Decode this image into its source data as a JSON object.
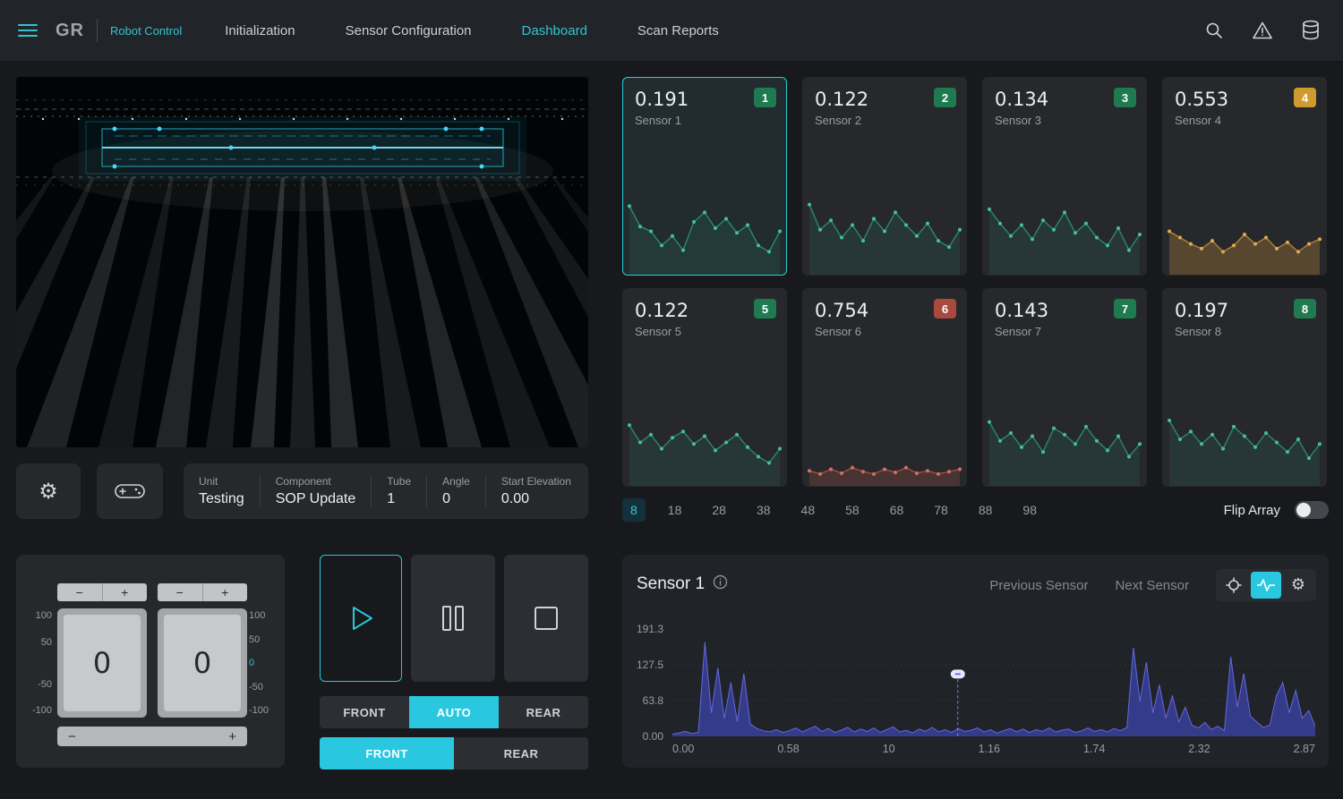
{
  "nav": {
    "logo": "GR",
    "brand": "Robot Control",
    "items": [
      {
        "label": "Initialization",
        "active": false
      },
      {
        "label": "Sensor Configuration",
        "active": false
      },
      {
        "label": "Dashboard",
        "active": true
      },
      {
        "label": "Scan Reports",
        "active": false
      }
    ],
    "accent_color": "#35c2ce"
  },
  "icons": {
    "gear": "⚙"
  },
  "info_panel": {
    "fields": [
      {
        "label": "Unit",
        "value": "Testing"
      },
      {
        "label": "Component",
        "value": "SOP Update"
      },
      {
        "label": "Tube",
        "value": "1"
      },
      {
        "label": "Angle",
        "value": "0"
      },
      {
        "label": "Start Elevation",
        "value": "0.00"
      }
    ]
  },
  "sensors": {
    "cards": [
      {
        "value": "0.191",
        "name": "Sensor 1",
        "badge": "1",
        "badge_color": "#1f7a50",
        "line_color": "#2f9d7b",
        "dot_color": "#45c197",
        "fill_opacity": 0.13,
        "selected": true,
        "spark": [
          78,
          52,
          46,
          28,
          40,
          22,
          58,
          70,
          50,
          62,
          44,
          54,
          28,
          20,
          46
        ]
      },
      {
        "value": "0.122",
        "name": "Sensor 2",
        "badge": "2",
        "badge_color": "#1f7a50",
        "line_color": "#2f9d7b",
        "dot_color": "#45c197",
        "fill_opacity": 0.13,
        "selected": false,
        "spark": [
          80,
          48,
          60,
          38,
          54,
          34,
          62,
          46,
          70,
          54,
          40,
          56,
          34,
          26,
          48
        ]
      },
      {
        "value": "0.134",
        "name": "Sensor 3",
        "badge": "3",
        "badge_color": "#1f7a50",
        "line_color": "#2f9d7b",
        "dot_color": "#45c197",
        "fill_opacity": 0.13,
        "selected": false,
        "spark": [
          74,
          56,
          40,
          54,
          36,
          60,
          48,
          70,
          44,
          56,
          38,
          28,
          50,
          22,
          42
        ]
      },
      {
        "value": "0.553",
        "name": "Sensor 4",
        "badge": "4",
        "badge_color": "#cf9b2f",
        "line_color": "#c9923a",
        "dot_color": "#e0aa4e",
        "fill_opacity": 0.3,
        "selected": false,
        "spark": [
          46,
          38,
          30,
          24,
          34,
          20,
          28,
          42,
          30,
          38,
          24,
          32,
          20,
          30,
          36
        ]
      },
      {
        "value": "0.122",
        "name": "Sensor 5",
        "badge": "5",
        "badge_color": "#1f7a50",
        "line_color": "#2f9d7b",
        "dot_color": "#45c197",
        "fill_opacity": 0.13,
        "selected": false,
        "spark": [
          68,
          46,
          56,
          38,
          52,
          60,
          44,
          54,
          36,
          46,
          56,
          40,
          28,
          20,
          38
        ]
      },
      {
        "value": "0.754",
        "name": "Sensor 6",
        "badge": "6",
        "badge_color": "#a84a3e",
        "line_color": "#b5584a",
        "dot_color": "#d4705f",
        "fill_opacity": 0.25,
        "selected": false,
        "spark": [
          10,
          6,
          12,
          7,
          14,
          9,
          6,
          12,
          8,
          14,
          7,
          10,
          6,
          9,
          12
        ]
      },
      {
        "value": "0.143",
        "name": "Sensor 7",
        "badge": "7",
        "badge_color": "#1f7a50",
        "line_color": "#2f9d7b",
        "dot_color": "#45c197",
        "fill_opacity": 0.13,
        "selected": false,
        "spark": [
          72,
          48,
          58,
          40,
          54,
          34,
          64,
          56,
          44,
          66,
          48,
          36,
          54,
          28,
          44
        ]
      },
      {
        "value": "0.197",
        "name": "Sensor 8",
        "badge": "8",
        "badge_color": "#1f7a50",
        "line_color": "#2f9d7b",
        "dot_color": "#45c197",
        "fill_opacity": 0.13,
        "selected": false,
        "spark": [
          74,
          50,
          60,
          44,
          56,
          38,
          66,
          54,
          40,
          58,
          46,
          34,
          50,
          26,
          44
        ]
      }
    ],
    "pages": [
      "8",
      "18",
      "28",
      "38",
      "48",
      "58",
      "68",
      "78",
      "88",
      "98"
    ],
    "active_index": 0,
    "flip_label": "Flip Array",
    "flip_on": false,
    "selected_border": "#2fc9db"
  },
  "steppers": {
    "left_value": "0",
    "right_value": "0",
    "scale_left": [
      "100",
      "50",
      "",
      "-50",
      "-100"
    ],
    "scale_right": [
      "100",
      "50",
      "0",
      "-50",
      "-100"
    ],
    "minus": "−",
    "plus": "+"
  },
  "transport": {
    "row1": [
      "FRONT",
      "AUTO",
      "REAR"
    ],
    "row1_active": "AUTO",
    "row2": [
      "FRONT",
      "REAR"
    ],
    "row2_active": "FRONT",
    "active_color": "#29c8e0"
  },
  "chart_panel": {
    "title": "Sensor 1",
    "prev_label": "Previous Sensor",
    "next_label": "Next Sensor",
    "chart_data": {
      "type": "area",
      "ylabels": [
        "191.3",
        "127.5",
        "63.8",
        "0.00"
      ],
      "xlabels": [
        "0.00",
        "0.58",
        "10",
        "1.16",
        "1.74",
        "2.32",
        "2.87"
      ],
      "ymax": 191.3,
      "line_color": "#6468e0",
      "fill_color": "#4550d8",
      "marker_fraction": 0.444,
      "values": [
        4,
        6,
        9,
        5,
        7,
        168,
        42,
        122,
        32,
        96,
        26,
        112,
        22,
        14,
        10,
        8,
        12,
        7,
        10,
        15,
        8,
        13,
        18,
        9,
        14,
        7,
        11,
        16,
        8,
        13,
        9,
        15,
        7,
        12,
        17,
        8,
        11,
        6,
        13,
        9,
        16,
        8,
        12,
        7,
        14,
        9,
        11,
        15,
        8,
        12,
        6,
        10,
        14,
        8,
        13,
        7,
        12,
        9,
        15,
        8,
        11,
        13,
        7,
        10,
        15,
        9,
        12,
        8,
        14,
        10,
        16,
        158,
        62,
        132,
        42,
        92,
        32,
        72,
        26,
        52,
        20,
        15,
        25,
        12,
        18,
        10,
        142,
        52,
        112,
        36,
        26,
        16,
        20,
        72,
        96,
        42,
        82,
        32,
        46,
        18
      ]
    }
  }
}
